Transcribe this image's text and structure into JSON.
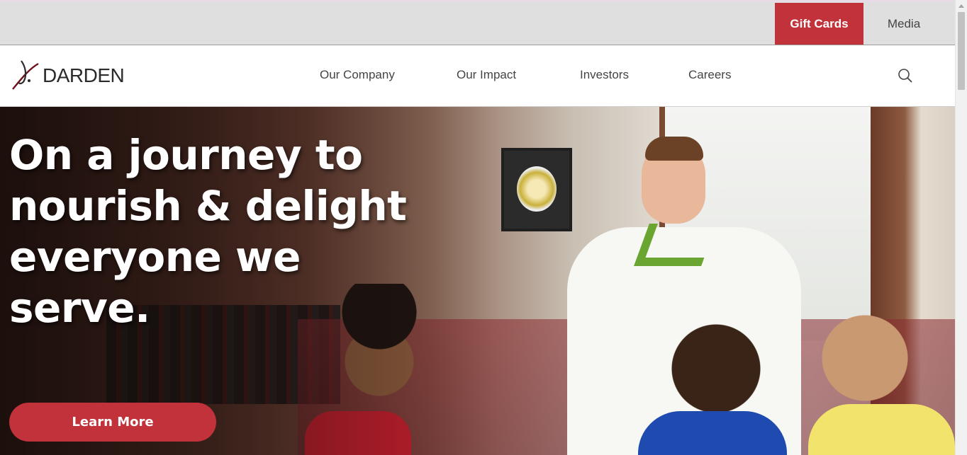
{
  "utility_bar": {
    "gift_cards_label": "Gift Cards",
    "media_label": "Media",
    "accent_color": "#c2323a"
  },
  "header": {
    "logo_text": "DARDEN",
    "nav": [
      {
        "label": "Our Company"
      },
      {
        "label": "Our Impact"
      },
      {
        "label": "Investors"
      },
      {
        "label": "Careers"
      }
    ],
    "search_icon": "search-icon"
  },
  "hero": {
    "headline": "On a journey to nourish & delight everyone we serve.",
    "cta_label": "Learn More",
    "cta_color": "#c2323a"
  }
}
